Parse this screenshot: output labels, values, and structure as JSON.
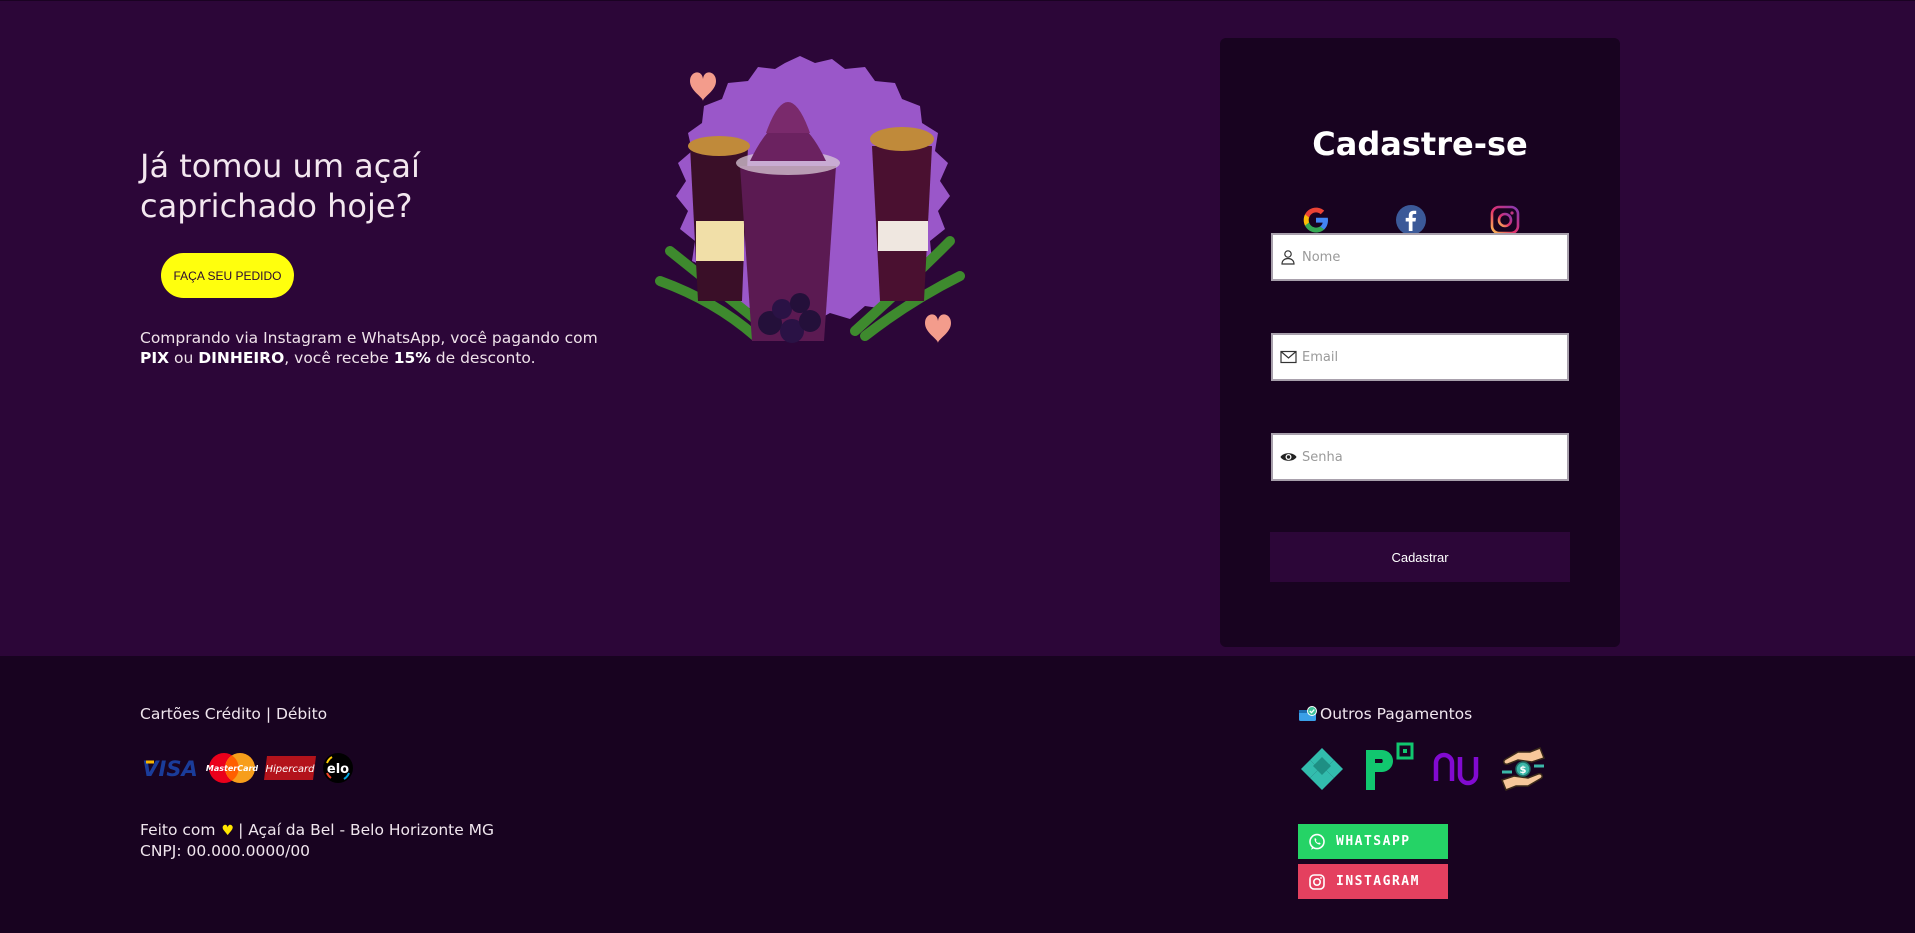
{
  "hero": {
    "headline": "Já tomou um açaí caprichado hoje?",
    "order_button": "FAÇA SEU PEDIDO",
    "promo": {
      "part1": "Comprando via Instagram e WhatsApp, você pagando com ",
      "pix": "PIX",
      "part2": " ou ",
      "cash": "DINHEIRO",
      "part3": ", você recebe ",
      "discount": "15%",
      "part4": " de desconto."
    }
  },
  "signup": {
    "title": "Cadastre-se",
    "social": [
      "google-icon",
      "facebook-icon",
      "instagram-icon"
    ],
    "name_placeholder": "Nome",
    "email_placeholder": "Email",
    "password_placeholder": "Senha",
    "submit_label": "Cadastrar"
  },
  "footer": {
    "cards_title": "Cartões Crédito | Débito",
    "card_brands": [
      "VISA",
      "MasterCard",
      "Hipercard",
      "elo"
    ],
    "credit_prefix": "Feito com",
    "credit_suffix": "| Açaí da Bel - Belo Horizonte MG",
    "cnpj": "CNPJ: 00.000.0000/00",
    "other_title": "Outros Pagamentos",
    "other_payments": [
      "pix-icon",
      "picpay-icon",
      "nubank-icon",
      "handshake-money-icon"
    ],
    "whatsapp_label": "WHATSAPP",
    "instagram_label": "INSTAGRAM"
  },
  "colors": {
    "hero_bg": "#2c0638",
    "card_bg": "#180320",
    "footer_bg": "#180320",
    "order_button": "#ffff0d",
    "whatsapp": "#25d366",
    "instagram": "#e4405f"
  }
}
